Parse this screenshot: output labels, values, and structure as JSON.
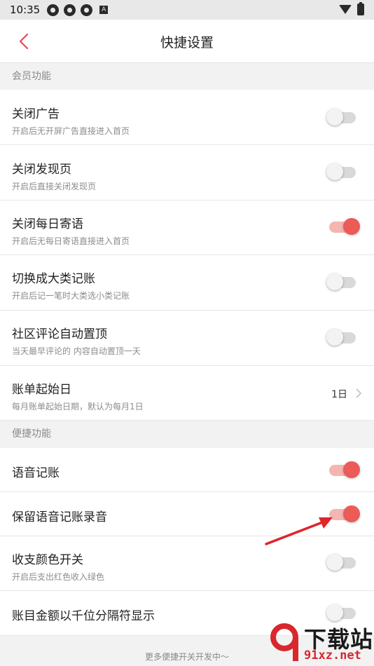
{
  "status_bar": {
    "time": "10:35",
    "a_badge": "A"
  },
  "header": {
    "title": "快捷设置"
  },
  "sections": [
    {
      "label": "会员功能",
      "items": [
        {
          "title": "关闭广告",
          "desc": "开启后无开屏广告直接进入首页",
          "type": "toggle",
          "on": false
        },
        {
          "title": "关闭发现页",
          "desc": "开启后直接关闭发现页",
          "type": "toggle",
          "on": false
        },
        {
          "title": "关闭每日寄语",
          "desc": "开启后无每日寄语直接进入首页",
          "type": "toggle",
          "on": true
        },
        {
          "title": "切换成大类记账",
          "desc": " 开启后记一笔时大类选小类记账",
          "type": "toggle",
          "on": false
        },
        {
          "title": "社区评论自动置顶",
          "desc": "当天最早评论的 内容自动置顶一天",
          "type": "toggle",
          "on": false
        },
        {
          "title": "账单起始日",
          "desc": "每月账单起始日期，默认为每月1日",
          "type": "value",
          "value": "1日"
        }
      ]
    },
    {
      "label": "便捷功能",
      "items": [
        {
          "title": "语音记账",
          "type": "toggle",
          "on": true
        },
        {
          "title": "保留语音记账录音",
          "type": "toggle",
          "on": true
        },
        {
          "title": "收支颜色开关",
          "desc": "开启后支出红色收入绿色",
          "type": "toggle",
          "on": false
        },
        {
          "title": "账目金额以千位分隔符显示",
          "type": "toggle",
          "on": false
        }
      ]
    }
  ],
  "footer": {
    "text": "更多便捷开关开发中～"
  },
  "watermark": {
    "title": "下载站",
    "url": "91xz.net"
  },
  "colors": {
    "accent": "#ec5b57",
    "accent_track": "#f5b5b1",
    "arrow": "#e0242b"
  },
  "icons": {
    "back": "chevron-left-icon",
    "chevron": "chevron-right-icon"
  }
}
